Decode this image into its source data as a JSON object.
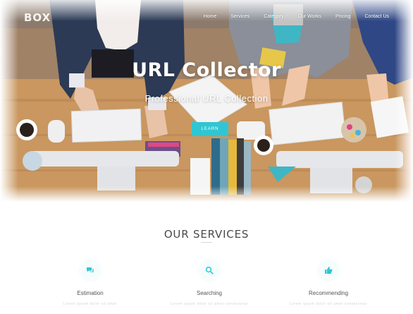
{
  "brand": {
    "logo_text": "BOX"
  },
  "nav": {
    "items": [
      {
        "label": "Home"
      },
      {
        "label": "Services"
      },
      {
        "label": "Category"
      },
      {
        "label": "Our Works"
      },
      {
        "label": "Pricing"
      },
      {
        "label": "Contact Us"
      }
    ]
  },
  "hero": {
    "title": "URL Collector",
    "subtitle": "Professional URL Collection",
    "cta_label": "LEARN",
    "accent_color": "#2fc6d3"
  },
  "services": {
    "title": "OUR SERVICES",
    "items": [
      {
        "name": "Estimation",
        "icon": "chat-icon",
        "desc": "Lorem ipsum dolor sit amet"
      },
      {
        "name": "Searching",
        "icon": "search-icon",
        "desc": "Lorem ipsum dolor sit amet consectetur"
      },
      {
        "name": "Recommending",
        "icon": "thumbs-up-icon",
        "desc": "Lorem ipsum dolor sit amet consectetur"
      }
    ]
  }
}
